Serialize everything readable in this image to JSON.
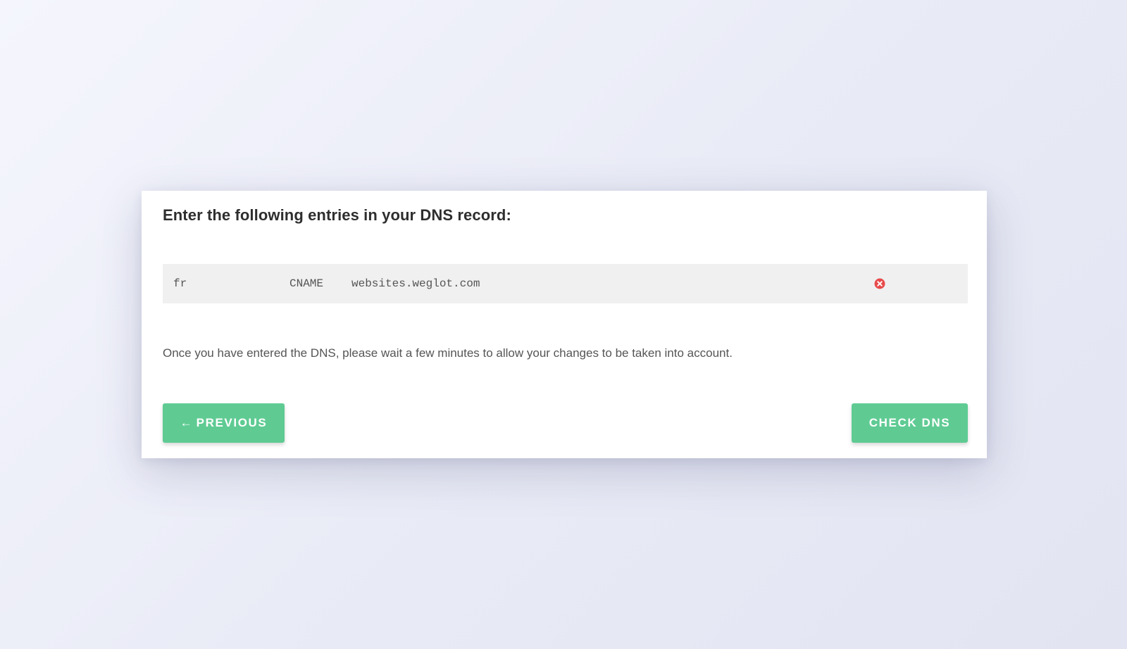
{
  "card": {
    "title": "Enter the following entries in your DNS record:",
    "dns_record": {
      "host": "fr",
      "type": "CNAME",
      "value": "websites.weglot.com",
      "status_icon": "error-circle-icon",
      "status_color": "#e84b4b"
    },
    "help_text": "Once you have entered the DNS, please wait a few minutes to allow your changes to be taken into account.",
    "previous_button": {
      "icon": "arrow-left-icon",
      "label": "PREVIOUS"
    },
    "check_button": {
      "label": "CHECK DNS"
    },
    "accent_color": "#5fcb93"
  }
}
